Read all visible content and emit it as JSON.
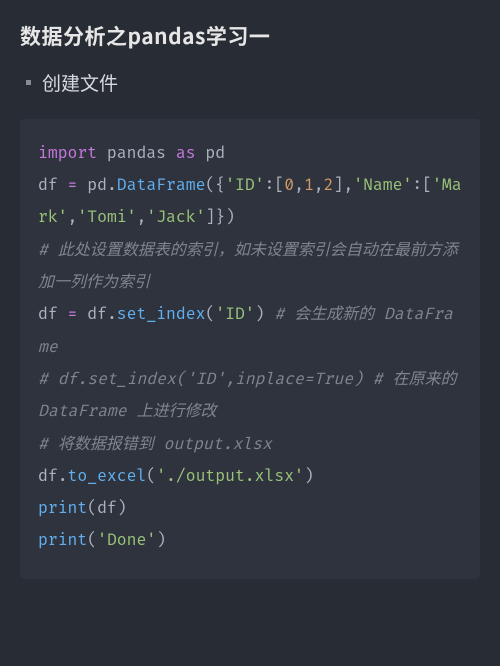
{
  "title": "数据分析之pandas学习一",
  "bullets": [
    "创建文件"
  ],
  "code": {
    "tokens": [
      {
        "t": "import",
        "c": "tk-kw"
      },
      {
        "t": " pandas ",
        "c": "tk-plain"
      },
      {
        "t": "as",
        "c": "tk-kw"
      },
      {
        "t": " pd",
        "c": "tk-plain"
      },
      {
        "t": "\n",
        "c": ""
      },
      {
        "t": "df ",
        "c": "tk-plain"
      },
      {
        "t": "=",
        "c": "tk-kw"
      },
      {
        "t": " pd.",
        "c": "tk-plain"
      },
      {
        "t": "DataFrame",
        "c": "tk-call"
      },
      {
        "t": "({",
        "c": "tk-plain"
      },
      {
        "t": "'ID'",
        "c": "tk-str"
      },
      {
        "t": ":[",
        "c": "tk-plain"
      },
      {
        "t": "0",
        "c": "tk-num"
      },
      {
        "t": ",",
        "c": "tk-plain"
      },
      {
        "t": "1",
        "c": "tk-num"
      },
      {
        "t": ",",
        "c": "tk-plain"
      },
      {
        "t": "2",
        "c": "tk-num"
      },
      {
        "t": "],",
        "c": "tk-plain"
      },
      {
        "t": "'Name'",
        "c": "tk-str"
      },
      {
        "t": ":[",
        "c": "tk-plain"
      },
      {
        "t": "'Mark'",
        "c": "tk-str"
      },
      {
        "t": ",",
        "c": "tk-plain"
      },
      {
        "t": "'Tomi'",
        "c": "tk-str"
      },
      {
        "t": ",",
        "c": "tk-plain"
      },
      {
        "t": "'Jack'",
        "c": "tk-str"
      },
      {
        "t": "]})",
        "c": "tk-plain"
      },
      {
        "t": "\n",
        "c": ""
      },
      {
        "t": "# 此处设置数据表的索引，如未设置索引会自动在最前方添加一列作为索引",
        "c": "tk-comment"
      },
      {
        "t": "\n",
        "c": ""
      },
      {
        "t": "df ",
        "c": "tk-plain"
      },
      {
        "t": "=",
        "c": "tk-kw"
      },
      {
        "t": " df.",
        "c": "tk-plain"
      },
      {
        "t": "set_index",
        "c": "tk-call"
      },
      {
        "t": "(",
        "c": "tk-plain"
      },
      {
        "t": "'ID'",
        "c": "tk-str"
      },
      {
        "t": ") ",
        "c": "tk-plain"
      },
      {
        "t": "# 会生成新的 DataFrame",
        "c": "tk-comment"
      },
      {
        "t": "\n",
        "c": ""
      },
      {
        "t": "# df.set_index('ID',inplace=True) # 在原来的 DataFrame 上进行修改",
        "c": "tk-comment"
      },
      {
        "t": "\n",
        "c": ""
      },
      {
        "t": "# 将数据报错到 output.xlsx",
        "c": "tk-comment"
      },
      {
        "t": "\n",
        "c": ""
      },
      {
        "t": "df.",
        "c": "tk-plain"
      },
      {
        "t": "to_excel",
        "c": "tk-call"
      },
      {
        "t": "(",
        "c": "tk-plain"
      },
      {
        "t": "'./output.xlsx'",
        "c": "tk-str"
      },
      {
        "t": ")",
        "c": "tk-plain"
      },
      {
        "t": "\n",
        "c": ""
      },
      {
        "t": "print",
        "c": "tk-call"
      },
      {
        "t": "(df)",
        "c": "tk-plain"
      },
      {
        "t": "\n",
        "c": ""
      },
      {
        "t": "print",
        "c": "tk-call"
      },
      {
        "t": "(",
        "c": "tk-plain"
      },
      {
        "t": "'Done'",
        "c": "tk-str"
      },
      {
        "t": ")",
        "c": "tk-plain"
      }
    ]
  }
}
